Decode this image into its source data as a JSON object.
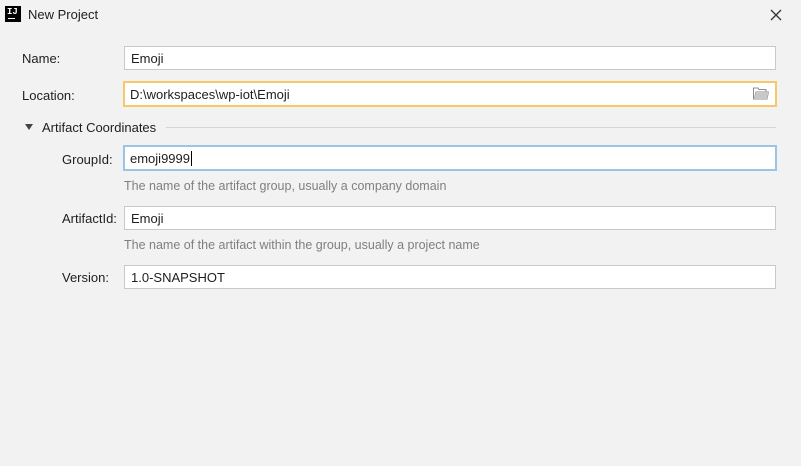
{
  "window": {
    "title": "New Project",
    "logo_text": "IJ"
  },
  "form": {
    "name": {
      "label": "Name:",
      "value": "Emoji"
    },
    "location": {
      "label": "Location:",
      "value": "D:\\workspaces\\wp-iot\\Emoji"
    },
    "section": {
      "label": "Artifact Coordinates",
      "expanded": true
    },
    "group_id": {
      "label": "GroupId:",
      "value": "emoji9999",
      "hint": "The name of the artifact group, usually a company domain"
    },
    "artifact_id": {
      "label": "ArtifactId:",
      "value": "Emoji",
      "hint": "The name of the artifact within the group, usually a project name"
    },
    "version": {
      "label": "Version:",
      "value": "1.0-SNAPSHOT"
    }
  },
  "icons": {
    "logo": "intellij-logo-icon",
    "close": "close-icon",
    "folder": "folder-icon",
    "toggle": "triangle-down-icon"
  },
  "colors": {
    "background": "#f2f2f2",
    "field_border": "#c9c9c9",
    "focus_location": "#f7c86b",
    "focus_groupid": "#9cc4e4",
    "hint_text": "#7f7f7f"
  }
}
